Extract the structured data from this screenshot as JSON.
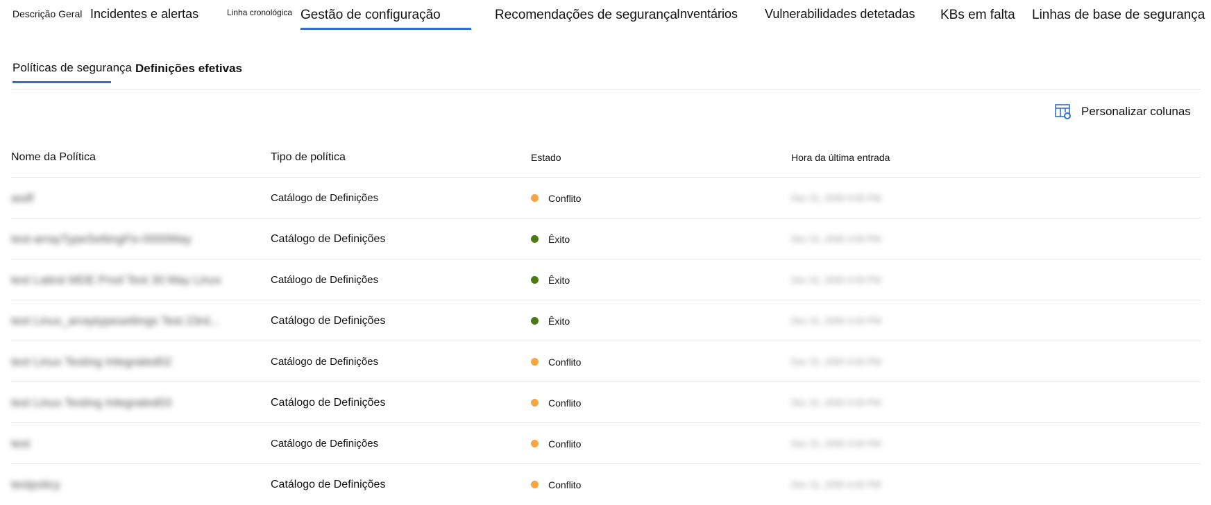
{
  "tabs": [
    {
      "label": "Descrição Geral"
    },
    {
      "label": "Incidentes e alertas"
    },
    {
      "label": "Linha cronológica"
    },
    {
      "label": "Gestão de configuração",
      "active": true
    },
    {
      "label": "Recomendações de segurança"
    },
    {
      "label": "Inventários"
    },
    {
      "label": "Vulnerabilidades detetadas"
    },
    {
      "label": "KBs em falta"
    },
    {
      "label": "Linhas de base de segurança"
    }
  ],
  "subtabs": [
    {
      "label": "Políticas de segurança",
      "active": true
    },
    {
      "label": "Definições efetivas"
    }
  ],
  "customize_columns": "Personalizar colunas",
  "columns": [
    "Nome da Política",
    "Tipo de política",
    "Estado",
    "Hora da última entrada"
  ],
  "colors": {
    "accent": "#2f6fd1",
    "conflict": "#f7a541",
    "success": "#4a7c10"
  },
  "rows": [
    {
      "name": "asdf",
      "type": "Catálogo de Definições",
      "status": "Conflito",
      "time": "Dec 31, 2000 4:00 PM"
    },
    {
      "name": "test-arrayTypeSettingFix-0000May",
      "type": "Catálogo de Definições",
      "status": "Êxito",
      "time": "Dec 31, 2000 4:00 PM"
    },
    {
      "name": "test Latest MDE Prod Test 30 May Linux",
      "type": "Catálogo de Definições",
      "status": "Êxito",
      "time": "Dec 31, 2000 4:00 PM"
    },
    {
      "name": "test Linux_arraytypesettings Test 23rd...",
      "type": "Catálogo de Definições",
      "status": "Êxito",
      "time": "Dec 31, 2000 4:00 PM"
    },
    {
      "name": "test Linux Testing Integrated02",
      "type": "Catálogo de Definições",
      "status": "Conflito",
      "time": "Dec 31, 2000 4:00 PM"
    },
    {
      "name": "test Linux Testing Integrated03",
      "type": "Catálogo de Definições",
      "status": "Conflito",
      "time": "Dec 31, 2000 4:00 PM"
    },
    {
      "name": "test",
      "type": "Catálogo de Definições",
      "status": "Conflito",
      "time": "Dec 31, 2000 4:00 PM"
    },
    {
      "name": "testpolicy",
      "type": "Catálogo de Definições",
      "status": "Conflito",
      "time": "Dec 31, 2000 4:00 PM"
    }
  ]
}
